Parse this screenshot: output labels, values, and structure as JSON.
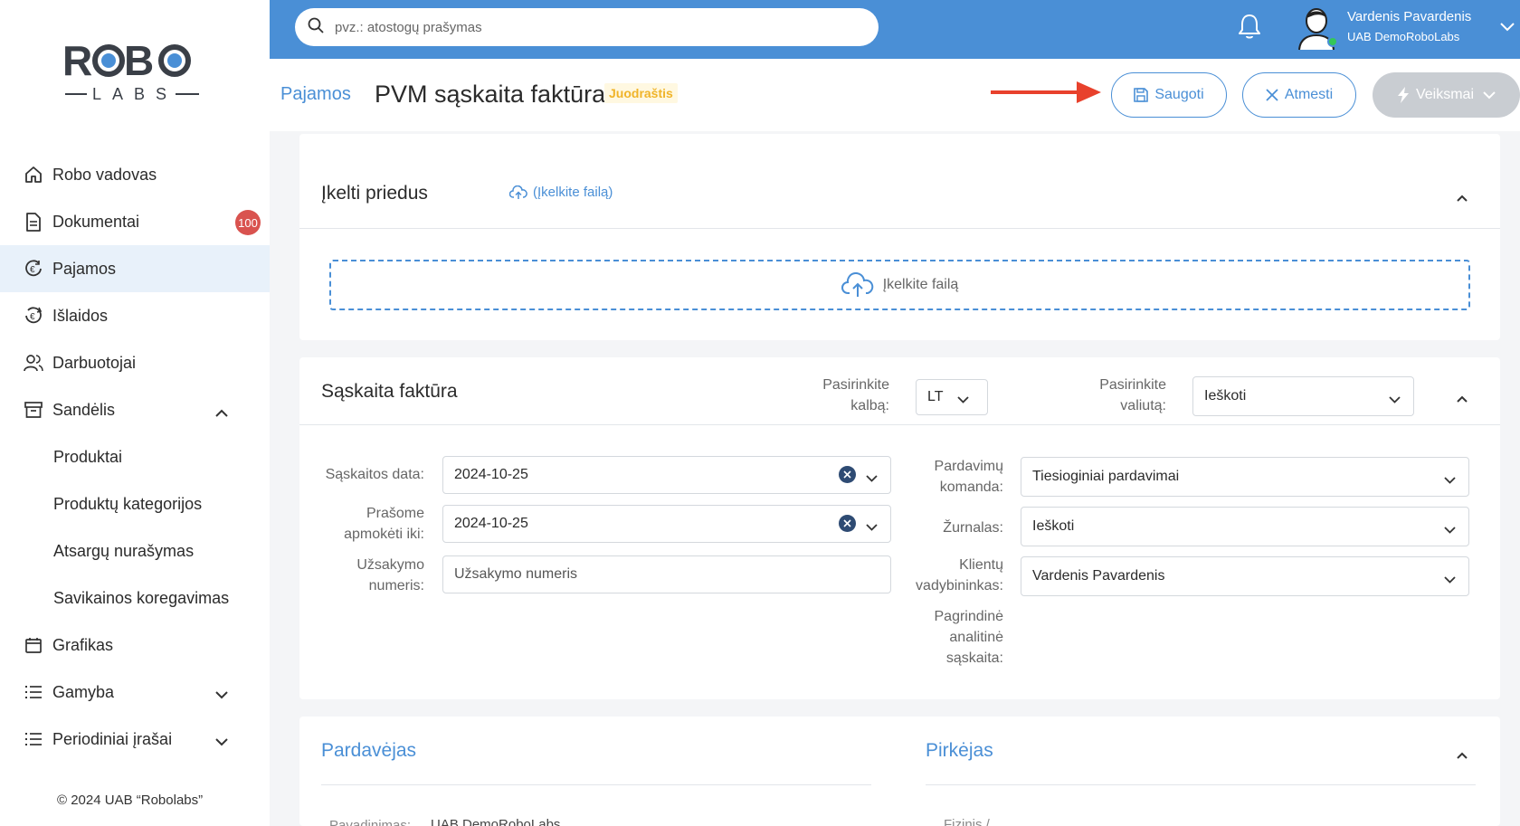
{
  "sidebar": {
    "logo_top": "ROBO",
    "logo_bottom": "LABS",
    "items": [
      {
        "label": "Robo vadovas"
      },
      {
        "label": "Dokumentai",
        "badge": "100"
      },
      {
        "label": "Pajamos"
      },
      {
        "label": "Išlaidos"
      },
      {
        "label": "Darbuotojai"
      },
      {
        "label": "Sandėlis"
      },
      {
        "label": "Produktai"
      },
      {
        "label": "Produktų kategorijos"
      },
      {
        "label": "Atsargų nurašymas"
      },
      {
        "label": "Savikainos koregavimas"
      },
      {
        "label": "Grafikas"
      },
      {
        "label": "Gamyba"
      },
      {
        "label": "Periodiniai įrašai"
      }
    ],
    "copyright": "© 2024 UAB “Robolabs”"
  },
  "topbar": {
    "search_placeholder": "pvz.: atostogų prašymas",
    "user_name": "Vardenis Pavardenis",
    "user_company": "UAB DemoRoboLabs",
    "accent": "#4a8fd6"
  },
  "header": {
    "breadcrumb": "Pajamos",
    "title": "PVM sąskaita faktūra",
    "status": "Juodraštis",
    "save_label": "Saugoti",
    "discard_label": "Atmesti",
    "actions_label": "Veiksmai"
  },
  "attachments": {
    "title": "Įkelti priedus",
    "upload_link": "(Įkelkite failą)",
    "dropzone_label": "Įkelkite failą"
  },
  "invoice": {
    "title": "Sąskaita faktūra",
    "language_label": "Pasirinkite kalbą:",
    "language_label_l1": "Pasirinkite",
    "language_label_l2": "kalbą:",
    "language_value": "LT",
    "currency_label_l1": "Pasirinkite",
    "currency_label_l2": "valiutą:",
    "currency_value": "Ieškoti",
    "invoice_date_label": "Sąskaitos data:",
    "invoice_date_value": "2024-10-25",
    "due_label_l1": "Prašome",
    "due_label_l2": "apmokėti iki:",
    "due_value": "2024-10-25",
    "order_label_l1": "Užsakymo",
    "order_label_l2": "numeris:",
    "order_placeholder": "Užsakymo numeris",
    "sales_team_label_l1": "Pardavimų",
    "sales_team_label_l2": "komanda:",
    "sales_team_value": "Tiesioginiai pardavimai",
    "journal_label": "Žurnalas:",
    "journal_value": "Ieškoti",
    "manager_label_l1": "Klientų",
    "manager_label_l2": "vadybininkas:",
    "manager_value": "Vardenis Pavardenis",
    "analytic_label_l1": "Pagrindinė",
    "analytic_label_l2": "analitinė",
    "analytic_label_l3": "sąskaita:"
  },
  "parties": {
    "seller_title": "Pardavėjas",
    "buyer_title": "Pirkėjas",
    "seller_cut_label": "Pavadinimas:",
    "seller_cut_value": "UAB DemoRoboLabs",
    "buyer_cut_label": "Fizinis /"
  }
}
